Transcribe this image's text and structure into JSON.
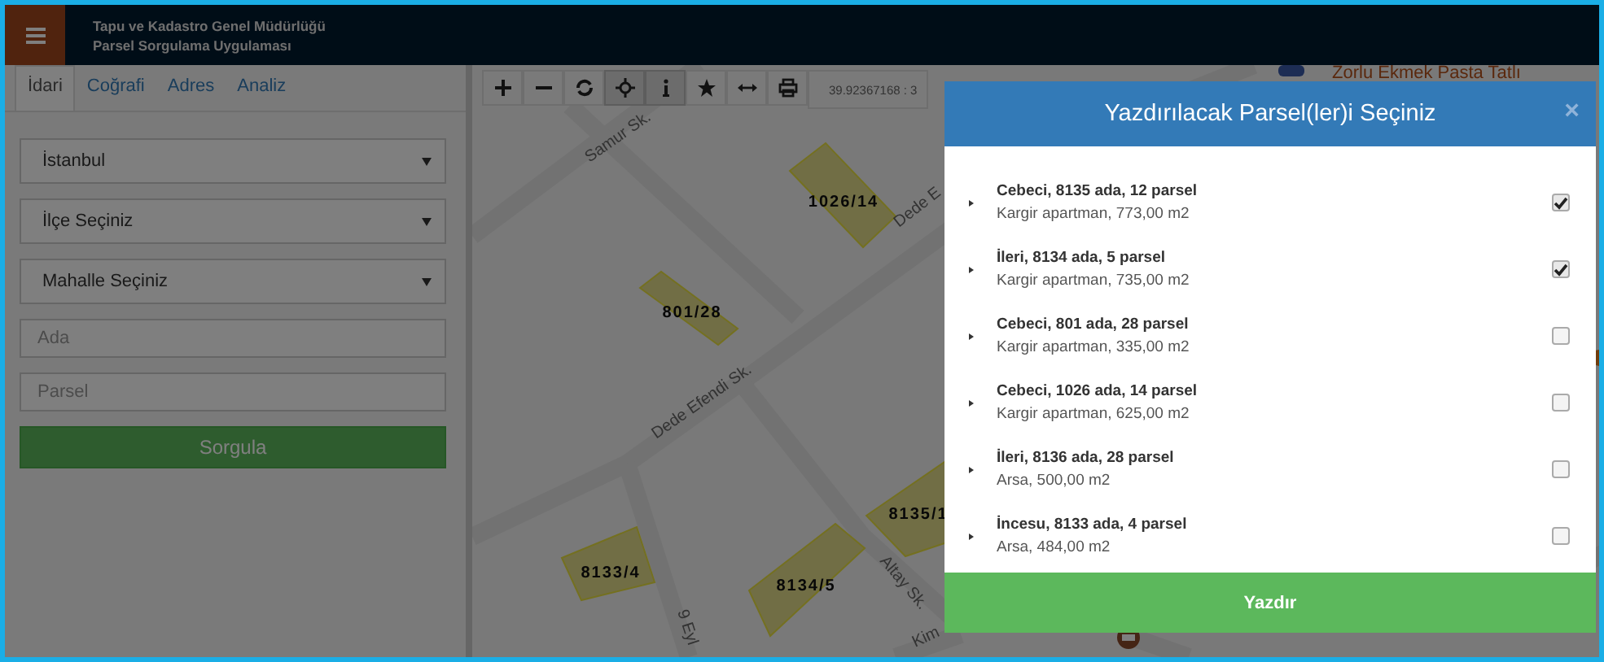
{
  "header": {
    "title_lines": [
      "Tapu ve Kadastro Genel Müdürlüğü",
      "Parsel Sorgulama Uygulaması"
    ]
  },
  "sidebar": {
    "tabs": [
      {
        "label": "İdari",
        "selected": true
      },
      {
        "label": "Coğrafi",
        "selected": false
      },
      {
        "label": "Adres",
        "selected": false
      },
      {
        "label": "Analiz",
        "selected": false
      }
    ],
    "selects": [
      "İstanbul",
      "İlçe Seçiniz",
      "Mahalle Seçiniz"
    ],
    "inputs": [
      {
        "placeholder": "Ada"
      },
      {
        "placeholder": "Parsel"
      }
    ],
    "button": "Sorgula"
  },
  "map": {
    "tools": [
      {
        "kind": "zoom-in",
        "active": false
      },
      {
        "kind": "zoom-out",
        "active": false
      },
      {
        "kind": "refresh",
        "active": false
      },
      {
        "kind": "pan",
        "active": true
      },
      {
        "kind": "info",
        "active": true
      },
      {
        "kind": "star",
        "active": false
      },
      {
        "kind": "measure",
        "active": false
      },
      {
        "kind": "print",
        "active": false
      }
    ],
    "coordinates": "39.92367168 : 3",
    "parcels": [
      {
        "label": "1026/14",
        "selected": false
      },
      {
        "label": "801/28",
        "selected": false
      },
      {
        "label": "8133/4",
        "selected": false
      },
      {
        "label": "8134/5",
        "selected": false
      },
      {
        "label": "8135/1",
        "selected": false
      }
    ],
    "streets": [
      {
        "name": "Samur Sk."
      },
      {
        "name": "Dede Efendi Sk."
      },
      {
        "name": "Dede E"
      },
      {
        "name": "Altay Sk."
      },
      {
        "name": "9 Eyl"
      },
      {
        "name": "Kim"
      }
    ],
    "poi": "Zorlu Ekmek Pasta Tatlı"
  },
  "modal": {
    "title": "Yazdırılacak Parsel(ler)i Seçiniz",
    "close": "×",
    "items": [
      {
        "title": "Cebeci, 8135 ada, 12 parsel",
        "detail": "Kargir apartman, 773,00 m2",
        "checked": true
      },
      {
        "title": "İleri, 8134 ada, 5 parsel",
        "detail": "Kargir apartman, 735,00 m2",
        "checked": true
      },
      {
        "title": "Cebeci, 801 ada, 28 parsel",
        "detail": "Kargir apartman, 335,00 m2",
        "checked": false
      },
      {
        "title": "Cebeci, 1026 ada, 14 parsel",
        "detail": "Kargir apartman, 625,00 m2",
        "checked": false
      },
      {
        "title": "İleri, 8136 ada, 28 parsel",
        "detail": "Arsa, 500,00 m2",
        "checked": false
      },
      {
        "title": "İncesu, 8133 ada, 4 parsel",
        "detail": "Arsa, 484,00 m2",
        "checked": false
      }
    ],
    "button": "Yazdır"
  }
}
